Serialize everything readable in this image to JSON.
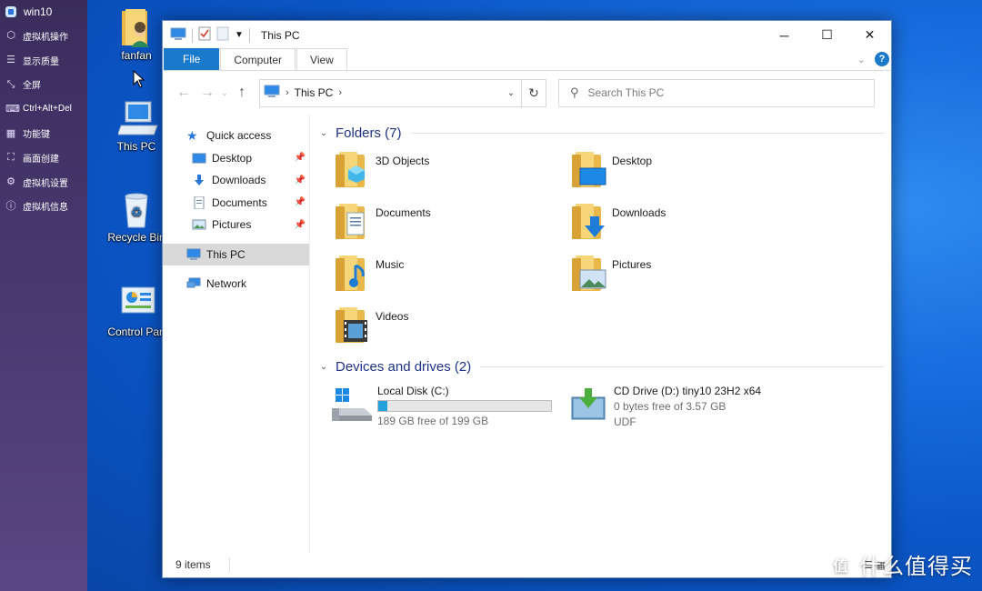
{
  "vm_panel": {
    "title": "win10",
    "items": [
      {
        "label": "虚拟机操作",
        "icon": "vm-ops-icon"
      },
      {
        "label": "显示质量",
        "icon": "display-quality-icon"
      },
      {
        "label": "全屏",
        "icon": "fullscreen-icon"
      },
      {
        "label": "Ctrl+Alt+Del",
        "icon": "keyboard-combo-icon"
      },
      {
        "label": "功能键",
        "icon": "function-keys-icon"
      },
      {
        "label": "画面创建",
        "icon": "screen-create-icon"
      },
      {
        "label": "虚拟机设置",
        "icon": "gear-icon"
      },
      {
        "label": "虚拟机信息",
        "icon": "info-icon"
      }
    ]
  },
  "desktop": {
    "icons": [
      {
        "label": "fanfan",
        "icon": "user-folder-icon"
      },
      {
        "label": "This PC",
        "icon": "computer-icon"
      },
      {
        "label": "Recycle Bin",
        "icon": "recycle-bin-icon"
      },
      {
        "label": "Control Pan",
        "icon": "control-panel-icon"
      }
    ]
  },
  "window": {
    "title": "This PC",
    "minimize": "─",
    "maximize": "☐",
    "close": "✕"
  },
  "ribbon": {
    "tabs": [
      "File",
      "Computer",
      "View"
    ],
    "expand_icon": "chevron-down-icon",
    "help": "?"
  },
  "address": {
    "path": "This PC",
    "search_placeholder": "Search This PC"
  },
  "nav": {
    "quick_access": "Quick access",
    "pinned": [
      {
        "label": "Desktop",
        "icon": "desktop-icon"
      },
      {
        "label": "Downloads",
        "icon": "download-icon"
      },
      {
        "label": "Documents",
        "icon": "document-icon"
      },
      {
        "label": "Pictures",
        "icon": "picture-icon"
      }
    ],
    "this_pc": "This PC",
    "network": "Network"
  },
  "folders": {
    "header": "Folders (7)",
    "items": [
      {
        "label": "3D Objects",
        "icon": "3d-objects-folder-icon"
      },
      {
        "label": "Desktop",
        "icon": "desktop-folder-icon"
      },
      {
        "label": "Documents",
        "icon": "documents-folder-icon"
      },
      {
        "label": "Downloads",
        "icon": "downloads-folder-icon"
      },
      {
        "label": "Music",
        "icon": "music-folder-icon"
      },
      {
        "label": "Pictures",
        "icon": "pictures-folder-icon"
      },
      {
        "label": "Videos",
        "icon": "videos-folder-icon"
      }
    ]
  },
  "drives": {
    "header": "Devices and drives (2)",
    "local": {
      "name": "Local Disk (C:)",
      "free": "189 GB free of 199 GB",
      "used_fraction": 0.05
    },
    "cd": {
      "name": "CD Drive (D:) tiny10 23H2 x64",
      "free": "0 bytes free of 3.57 GB",
      "fs": "UDF"
    }
  },
  "status": {
    "items": "9 items"
  },
  "watermark": {
    "logo": "值",
    "text": "什么值得买"
  }
}
